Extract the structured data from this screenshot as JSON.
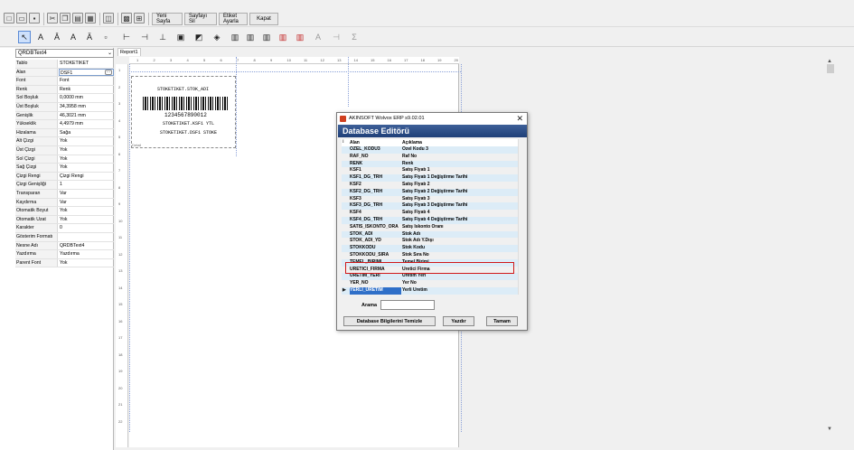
{
  "toolbar": {
    "buttons": [
      "Yeni Sayfa",
      "Sayfayı Sil",
      "Etiket Ayarla",
      "Kapat"
    ]
  },
  "properties": {
    "selected_object": "QRDBText4",
    "rows": [
      {
        "key": "Tablo",
        "value": "STOKETIKET"
      },
      {
        "key": "Alan",
        "value": "DSF1"
      },
      {
        "key": "Font",
        "value": "Font"
      },
      {
        "key": "Renk",
        "value": "Renk"
      },
      {
        "key": "Sol Boşluk",
        "value": "0,0000 mm"
      },
      {
        "key": "Üst Boşluk",
        "value": "34,3958 mm"
      },
      {
        "key": "Genişlik",
        "value": "46,3021 mm"
      },
      {
        "key": "Yükseklik",
        "value": "4,4979 mm"
      },
      {
        "key": "Hizalama",
        "value": "Sağa"
      },
      {
        "key": "Alt Çizgi",
        "value": "Yok"
      },
      {
        "key": "Üst Çizgi",
        "value": "Yok"
      },
      {
        "key": "Sol Çizgi",
        "value": "Yok"
      },
      {
        "key": "Sağ Çizgi",
        "value": "Yok"
      },
      {
        "key": "Çizgi Rengi",
        "value": "Çizgi Rengi"
      },
      {
        "key": "Çizgi Genişliği",
        "value": "1"
      },
      {
        "key": "Transparan",
        "value": "Var"
      },
      {
        "key": "Kaydırma",
        "value": "Var"
      },
      {
        "key": "Otomatik Boyut",
        "value": "Yok"
      },
      {
        "key": "Otomatik Uzat",
        "value": "Yok"
      },
      {
        "key": "Karakter",
        "value": "0"
      },
      {
        "key": "Gösterim Formatı",
        "value": ""
      },
      {
        "key": "Nesne Adı",
        "value": "QRDBText4"
      },
      {
        "key": "Yazdırma",
        "value": "Yazdırma"
      },
      {
        "key": "Parent Font",
        "value": "Yok"
      }
    ]
  },
  "designer": {
    "tab": "Report1",
    "ruler_h": [
      "1",
      "2",
      "3",
      "4",
      "5",
      "6",
      "7",
      "8",
      "9",
      "10",
      "11",
      "12",
      "13",
      "14",
      "15",
      "16",
      "17",
      "18",
      "19",
      "20"
    ],
    "ruler_v": [
      "1",
      "2",
      "3",
      "4",
      "5",
      "6",
      "7",
      "8",
      "9",
      "10",
      "11",
      "12",
      "13",
      "14",
      "15",
      "16",
      "17",
      "18",
      "19",
      "20",
      "21",
      "22"
    ],
    "label": {
      "stok_adi": "STOKETIKET.STOK_ADI",
      "barcode_number": "1234567890012",
      "price": "STOKETIKET.KSF1 YTL",
      "bottom": "STOKETIKET.DSF1 STOKE",
      "band": "Detail"
    }
  },
  "dialog": {
    "title": "AKINSOFT Wolvox ERP s9.02.01",
    "header": "Database Editörü",
    "columns": [
      "Alan",
      "Açıklama"
    ],
    "rows": [
      {
        "field": "OZEL_KODU3",
        "desc": "Özel Kodu 3"
      },
      {
        "field": "RAF_NO",
        "desc": "Raf No"
      },
      {
        "field": "RENK",
        "desc": "Renk"
      },
      {
        "field": "KSF1",
        "desc": "Satış Fiyatı 1"
      },
      {
        "field": "KSF1_DG_TRH",
        "desc": "Satış Fiyatı 1 Değiştirme Tarihi"
      },
      {
        "field": "KSF2",
        "desc": "Satış Fiyatı 2"
      },
      {
        "field": "KSF2_DG_TRH",
        "desc": "Satış Fiyatı 2 Değiştirme Tarihi"
      },
      {
        "field": "KSF3",
        "desc": "Satış Fiyatı 3"
      },
      {
        "field": "KSF3_DG_TRH",
        "desc": "Satış Fiyatı 3 Değiştirme Tarihi"
      },
      {
        "field": "KSF4",
        "desc": "Satış Fiyatı 4"
      },
      {
        "field": "KSF4_DG_TRH",
        "desc": "Satış Fiyatı 4 Değiştirme Tarihi"
      },
      {
        "field": "SATIS_ISKONTO_ORA",
        "desc": "Satış İskonto Oranı"
      },
      {
        "field": "STOK_ADI",
        "desc": "Stok Adı"
      },
      {
        "field": "STOK_ADI_YD",
        "desc": "Stok Adı Y.Dışı"
      },
      {
        "field": "STOKKODU",
        "desc": "Stok Kodu"
      },
      {
        "field": "STOKKODU_SIRA",
        "desc": "Stok Sıra No"
      },
      {
        "field": "TEMEL_BIRIMI",
        "desc": "Temel Birimi"
      },
      {
        "field": "URETICI_FIRMA",
        "desc": "Üretici Firma"
      },
      {
        "field": "URETIM_YERI",
        "desc": "Üretim Yeri"
      },
      {
        "field": "YER_NO",
        "desc": "Yer No"
      },
      {
        "field": "YERLI_URETIM",
        "desc": "Yerli Üretim"
      }
    ],
    "search_label": "Arama",
    "search_value": "",
    "btn_clear": "Database Bilgilerini Temizle",
    "btn_print": "Yazdır",
    "btn_ok": "Tamam"
  }
}
